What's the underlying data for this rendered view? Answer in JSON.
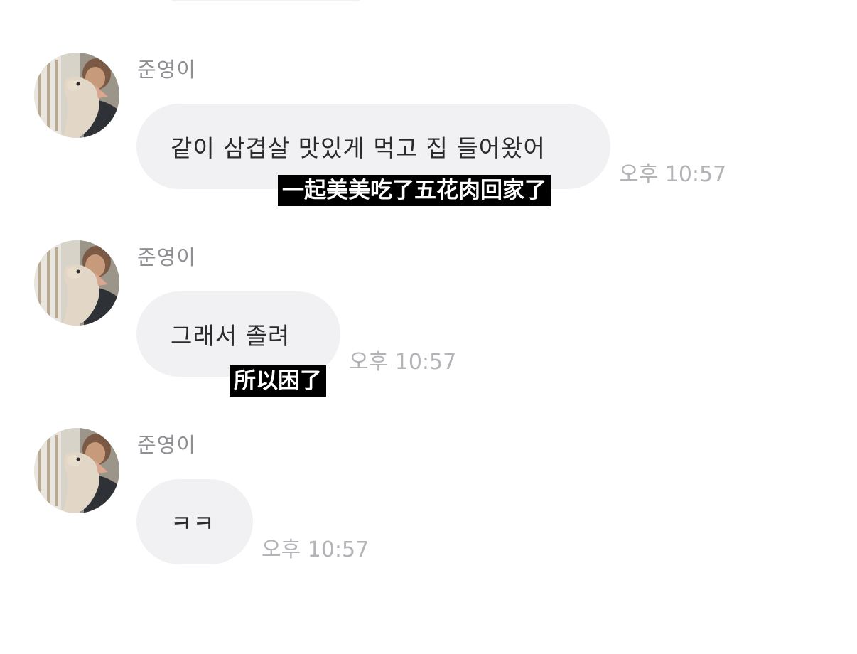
{
  "messages": [
    {
      "sender": "준영이",
      "text": "같이 삼겹살 맛있게 먹고 집 들어왔어",
      "time": "오후 10:57",
      "subtitle": "一起美美吃了五花肉回家了"
    },
    {
      "sender": "준영이",
      "text": "그래서 졸려",
      "time": "오후 10:57",
      "subtitle": "所以困了"
    },
    {
      "sender": "준영이",
      "text": "ㅋㅋ",
      "time": "오후 10:57"
    }
  ],
  "colors": {
    "bubble": "#f1f1f4",
    "sender_name": "#8e8e93",
    "timestamp": "#b3b3b8",
    "subtitle_bg": "#000000",
    "subtitle_text": "#ffffff"
  }
}
